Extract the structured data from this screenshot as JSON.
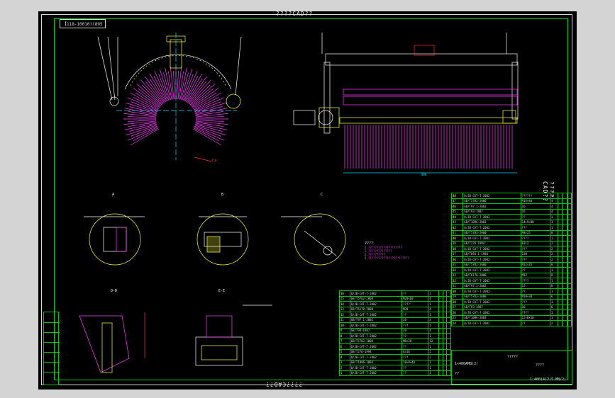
{
  "drawing": {
    "top_title": "????CAD??",
    "bottom_title": "????CAD??",
    "side_title": "????CAD??",
    "code_box": "【118-10010)(895"
  },
  "views": {
    "section_a": "A",
    "section_b": "B",
    "section_c": "C",
    "detail_d": "D-D",
    "detail_e": "E-E"
  },
  "notes": {
    "heading": "????",
    "lines": [
      "1.????????????????????",
      "2.??????????????",
      "3.??????????",
      "4.????????????????????????"
    ]
  },
  "parts_list_right": {
    "rows": [
      [
        "48",
        "Q/JB-CAT-T-2002",
        "??????",
        "1",
        "",
        "",
        ""
      ],
      [
        "47",
        "GB/T5782-2000",
        "M16×40",
        "4",
        "",
        "",
        ""
      ],
      [
        "46",
        "GB/T97.1-2002",
        "16",
        "4",
        "",
        "",
        ""
      ],
      [
        "45",
        "GB/T93-1987",
        "16",
        "4",
        "",
        "",
        ""
      ],
      [
        "44",
        "Q/JB-CAT-T-2002",
        "??",
        "1",
        "",
        "",
        ""
      ],
      [
        "43",
        "GB/T1096-2003",
        "14×9×80",
        "1",
        "",
        "",
        ""
      ],
      [
        "42",
        "Q/JB-CAT-T-2002",
        "???",
        "1",
        "",
        "",
        ""
      ],
      [
        "41",
        "GB/T5783-2000",
        "M8×25",
        "8",
        "",
        "",
        ""
      ],
      [
        "40",
        "Q/JB-CAT-T-2002",
        "????",
        "1",
        "",
        "",
        ""
      ],
      [
        "39",
        "GB/T276-1994",
        "6312",
        "2",
        "",
        "",
        ""
      ],
      [
        "38",
        "Q/JB-CAT-T-2002",
        "???",
        "2",
        "",
        "",
        ""
      ],
      [
        "37",
        "GB/T893.1-1986",
        "130",
        "2",
        "",
        "",
        ""
      ],
      [
        "36",
        "Q/JB-CAT-T-2002",
        "???",
        "2",
        "",
        "",
        ""
      ],
      [
        "35",
        "GB/T5782-2000",
        "M12×35",
        "8",
        "",
        "",
        ""
      ],
      [
        "34",
        "Q/JB-CAT-T-2002",
        "??",
        "1",
        "",
        "",
        ""
      ],
      [
        "33",
        "GB/T6170-2000",
        "M12",
        "8",
        "",
        "",
        ""
      ],
      [
        "32",
        "Q/JB-CAT-T-2002",
        "????",
        "1",
        "",
        "",
        ""
      ],
      [
        "31",
        "GB/T97.1-2002",
        "12",
        "8",
        "",
        "",
        ""
      ],
      [
        "30",
        "Q/JB-CAT-T-2002",
        "??",
        "1",
        "",
        "",
        ""
      ],
      [
        "29",
        "GB/T5783-2000",
        "M10×30",
        "6",
        "",
        "",
        ""
      ],
      [
        "28",
        "Q/JB-CAT-T-2002",
        "???",
        "1",
        "",
        "",
        ""
      ],
      [
        "27",
        "GB/T93-1987",
        "10",
        "6",
        "",
        "",
        ""
      ],
      [
        "26",
        "Q/JB-CAT-T-2002",
        "????",
        "1",
        "",
        "",
        ""
      ],
      [
        "25",
        "GB/T1096-2003",
        "12×8×50",
        "1",
        "",
        "",
        ""
      ],
      [
        "24",
        "Q/JB-CAT-T-2002",
        "??",
        "2",
        "",
        "",
        ""
      ]
    ]
  },
  "parts_list_left": {
    "rows": [
      [
        "16",
        "Q/JB-CAT-T-2002",
        "??",
        "2",
        "",
        "",
        ""
      ],
      [
        "15",
        "GB/T5782-2000",
        "M20×60",
        "4",
        "",
        "",
        ""
      ],
      [
        "14",
        "Q/JB-CAT-T-2002",
        "????",
        "1",
        "",
        "",
        ""
      ],
      [
        "13",
        "GB/T6170-2000",
        "M20",
        "4",
        "",
        "",
        ""
      ],
      [
        "12",
        "Q/JB-CAT-T-2002",
        "??",
        "1",
        "",
        "",
        ""
      ],
      [
        "11",
        "GB/T97.1-2002",
        "20",
        "4",
        "",
        "",
        ""
      ],
      [
        "10",
        "Q/JB-CAT-T-2002",
        "???",
        "1",
        "",
        "",
        ""
      ],
      [
        "9",
        "GB/T93-1987",
        "20",
        "4",
        "",
        "",
        ""
      ],
      [
        "8",
        "Q/JB-CAT-T-2002",
        "??",
        "1",
        "",
        "",
        ""
      ],
      [
        "7",
        "GB/T5783-2000",
        "M8×20",
        "12",
        "",
        "",
        ""
      ],
      [
        "6",
        "Q/JB-CAT-T-2002",
        "??",
        "1",
        "",
        "",
        ""
      ],
      [
        "5",
        "GB/T276-1994",
        "6310",
        "2",
        "",
        "",
        ""
      ],
      [
        "4",
        "Q/JB-CAT-T-2002",
        "???",
        "2",
        "",
        "",
        ""
      ],
      [
        "3",
        "GB/T1096-2003",
        "10×8×40",
        "1",
        "",
        "",
        ""
      ],
      [
        "2",
        "Q/JB-CAT-T-2002",
        "??",
        "1",
        "",
        "",
        ""
      ],
      [
        "1",
        "Q/JB-CAT-T-2002",
        "??",
        "1",
        "",
        "",
        ""
      ]
    ]
  },
  "title_block": {
    "name": "?????",
    "drawing_no": "1×400AMB(2)",
    "scale": "??",
    "company": "????",
    "sheet": "1:400(4)2(5.M8/2)"
  },
  "colors": {
    "frame": "#00d200",
    "background": "#000000",
    "brush": "#ff40ff",
    "shaft": "#ffff40",
    "outline": "#ffffff",
    "dimension": "#00e0ff",
    "detail_red": "#ff3030"
  }
}
